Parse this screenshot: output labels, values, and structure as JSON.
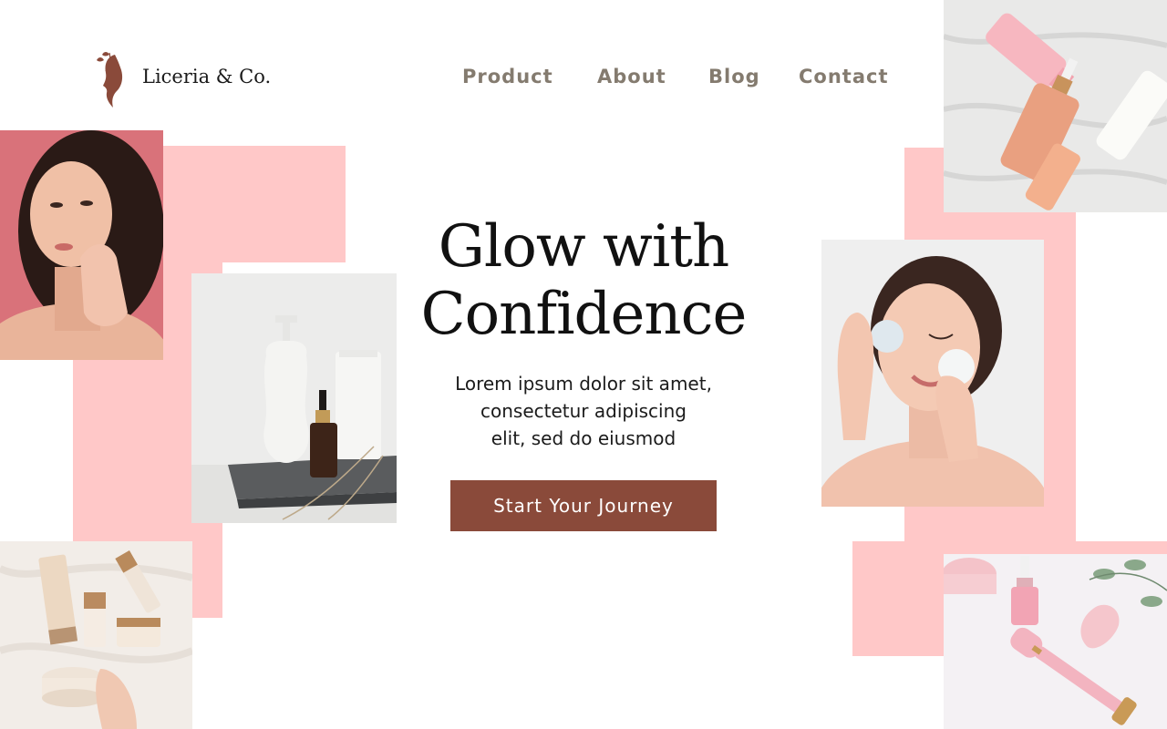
{
  "brand": {
    "name": "Liceria & Co.",
    "logo_icon": "woman-profile-leaf-icon"
  },
  "nav": {
    "items": [
      {
        "label": "Product"
      },
      {
        "label": "About"
      },
      {
        "label": "Blog"
      },
      {
        "label": "Contact"
      }
    ]
  },
  "hero": {
    "title_line1": "Glow with",
    "title_line2": "Confidence",
    "subtitle_line1": "Lorem ipsum dolor sit amet,",
    "subtitle_line2": "consectetur adipiscing",
    "subtitle_line3": "elit, sed do eiusmod",
    "cta_label": "Start Your Journey"
  },
  "colors": {
    "accent": "#8a4a3a",
    "pink_block": "#ffc8c8",
    "nav_text": "#847b6f",
    "heading_text": "#111111"
  },
  "images": [
    {
      "name": "woman-curly-hair-photo"
    },
    {
      "name": "skincare-bottles-photo"
    },
    {
      "name": "serum-and-tubes-photo"
    },
    {
      "name": "woman-cotton-pads-photo"
    },
    {
      "name": "cream-jars-photo"
    },
    {
      "name": "jade-roller-photo"
    }
  ]
}
